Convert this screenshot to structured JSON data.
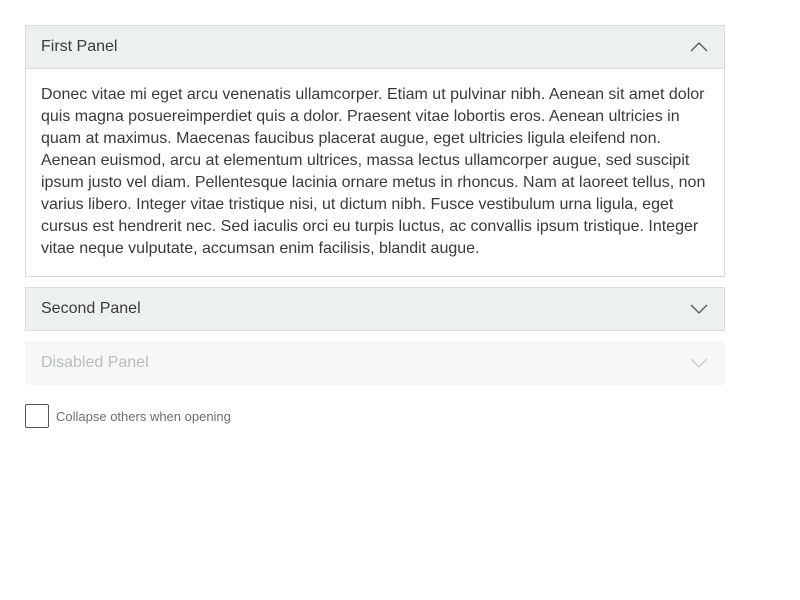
{
  "accordion": {
    "panels": [
      {
        "title": "First Panel",
        "state": "expanded",
        "chevron_icon": "chevron-up-icon",
        "content": "Donec vitae mi eget arcu venenatis ullamcorper. Etiam ut pulvinar nibh. Aenean sit amet dolor quis magna posuereimperdiet quis a dolor. Praesent vitae lobortis eros. Aenean ultricies in quam at maximus. Maecenas faucibus placerat augue, eget ultricies ligula eleifend non. Aenean euismod, arcu at elementum ultrices, massa lectus ullamcorper augue, sed suscipit ipsum justo vel diam. Pellentesque lacinia ornare metus in rhoncus. Nam at laoreet tellus, non varius libero. Integer vitae tristique nisi, ut dictum nibh. Fusce vestibulum urna ligula, eget cursus est hendrerit nec. Sed iaculis orci eu turpis luctus, ac convallis ipsum tristique. Integer vitae neque vulputate, accumsan enim facilisis, blandit augue."
      },
      {
        "title": "Second Panel",
        "state": "collapsed",
        "chevron_icon": "chevron-down-icon"
      },
      {
        "title": "Disabled Panel",
        "state": "disabled",
        "chevron_icon": "chevron-down-icon"
      }
    ]
  },
  "options": {
    "collapse_others_label": "Collapse others when opening",
    "collapse_others_checked": false
  },
  "colors": {
    "header_bg": "#edf0f1",
    "border": "#d9dcdd",
    "text": "#3a3a3a",
    "disabled_text": "#b9bcbd",
    "disabled_bg": "#f6f8f8"
  }
}
